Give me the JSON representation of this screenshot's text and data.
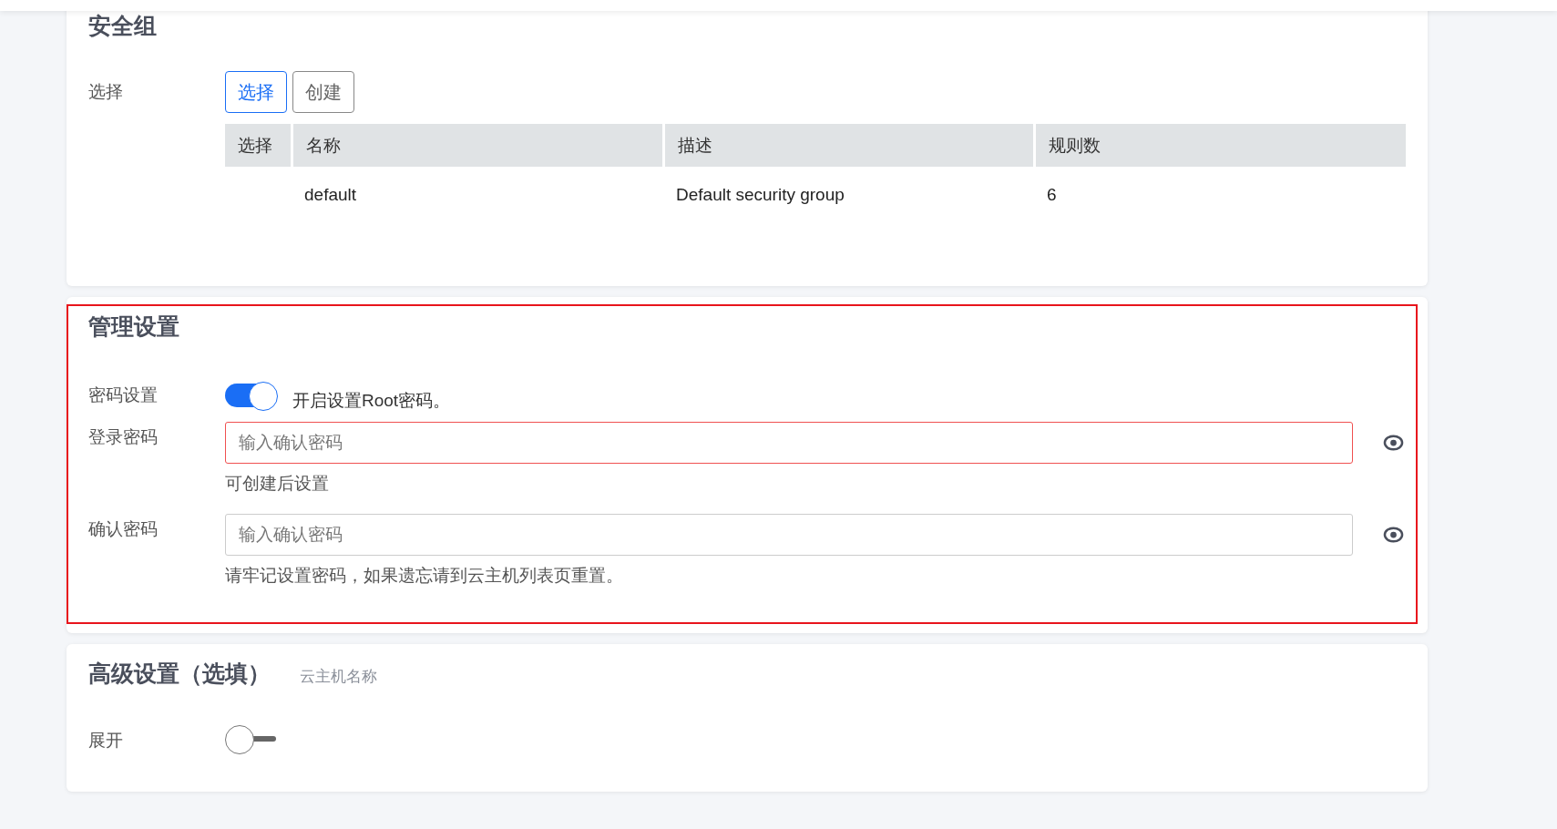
{
  "security_group": {
    "title": "安全组",
    "field_label": "选择",
    "buttons": [
      {
        "label": "选择",
        "selected": true
      },
      {
        "label": "创建",
        "selected": false
      }
    ],
    "table": {
      "columns": [
        "选择",
        "名称",
        "描述",
        "规则数"
      ],
      "rows": [
        {
          "name": "default",
          "description": "Default security group",
          "rules": "6"
        }
      ]
    }
  },
  "management": {
    "title": "管理设置",
    "highlighted": true,
    "password_toggle": {
      "label": "密码设置",
      "on": true,
      "text": "开启设置Root密码。"
    },
    "fields": [
      {
        "label": "登录密码",
        "placeholder": "输入确认密码",
        "invalid": true,
        "hint": "可创建后设置"
      },
      {
        "label": "确认密码",
        "placeholder": "输入确认密码",
        "invalid": false,
        "hint": "请牢记设置密码，如果遗忘请到云主机列表页重置。"
      }
    ]
  },
  "advanced": {
    "title": "高级设置（选填）",
    "subtitle": "云主机名称",
    "expand": {
      "label": "展开",
      "on": false
    }
  }
}
